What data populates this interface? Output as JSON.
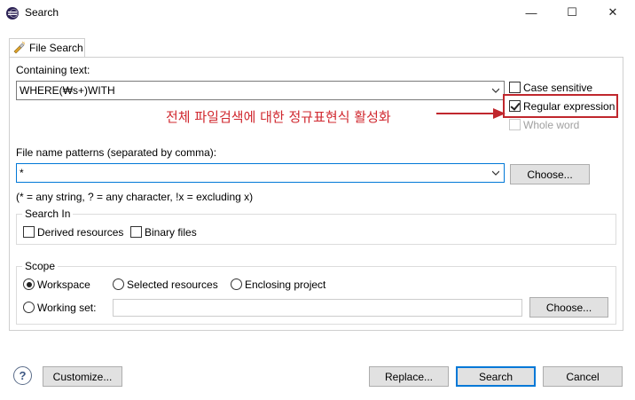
{
  "window": {
    "title": "Search",
    "minimize_glyph": "—",
    "maximize_glyph": "☐",
    "close_glyph": "✕"
  },
  "tab": {
    "label": "File Search",
    "icon": "flashlight-icon"
  },
  "containing_text": {
    "label": "Containing text:",
    "value": "WHERE(₩s+)WITH"
  },
  "options": {
    "case_sensitive": {
      "label": "Case sensitive",
      "checked": false
    },
    "regular_expression": {
      "label": "Regular expression",
      "checked": true
    },
    "whole_word": {
      "label": "Whole word",
      "checked": false,
      "enabled": false
    }
  },
  "annotation": {
    "text": "전체 파일검색에 대한 정규표현식 활성화",
    "color": "#d0282f"
  },
  "file_name_patterns": {
    "label": "File name patterns (separated by comma):",
    "value": "*",
    "choose_label": "Choose...",
    "hint": "(* = any string, ? = any character, !x = excluding x)"
  },
  "search_in": {
    "title": "Search In",
    "derived_resources": {
      "label": "Derived resources",
      "checked": false
    },
    "binary_files": {
      "label": "Binary files",
      "checked": false
    }
  },
  "scope": {
    "title": "Scope",
    "workspace": {
      "label": "Workspace",
      "selected": true
    },
    "selected_resources": {
      "label": "Selected resources",
      "selected": false
    },
    "enclosing_project": {
      "label": "Enclosing project",
      "selected": false
    },
    "working_set": {
      "label": "Working set:",
      "selected": false,
      "value": ""
    },
    "choose_label": "Choose..."
  },
  "footer": {
    "help_glyph": "?",
    "customize_label": "Customize...",
    "replace_label": "Replace...",
    "search_label": "Search",
    "cancel_label": "Cancel"
  },
  "colors": {
    "accent": "#0078d7",
    "annotation": "#c0272d"
  }
}
